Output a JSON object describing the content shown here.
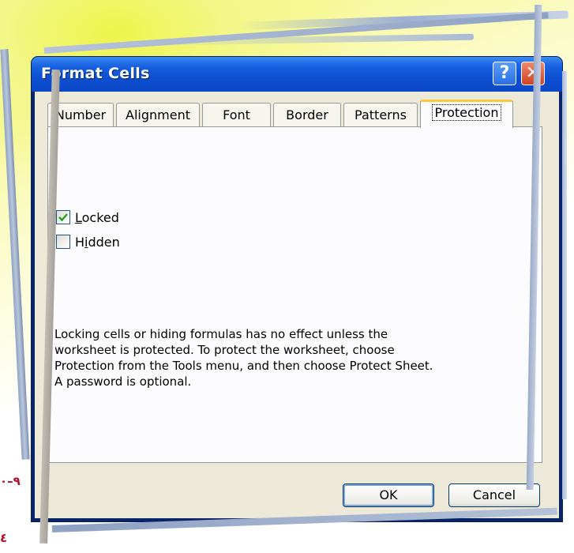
{
  "slide": {
    "page_marker_1": "٩–٠",
    "page_marker_2": "٤"
  },
  "dialog": {
    "title": "Format Cells",
    "help_label": "?",
    "close_label": "✕",
    "tabs": [
      {
        "label": "Number",
        "active": false
      },
      {
        "label": "Alignment",
        "active": false
      },
      {
        "label": "Font",
        "active": false
      },
      {
        "label": "Border",
        "active": false
      },
      {
        "label": "Patterns",
        "active": false
      },
      {
        "label": "Protection",
        "active": true
      }
    ],
    "locked": {
      "label_prefix": "",
      "label_accel": "L",
      "label_rest": "ocked",
      "checked": true
    },
    "hidden": {
      "label_prefix": "H",
      "label_accel": "i",
      "label_rest": "dden",
      "checked": false
    },
    "info_text": "Locking cells or hiding formulas has no effect unless the worksheet is protected. To protect the worksheet, choose Protection from the Tools menu, and then choose Protect Sheet. A password is optional.",
    "ok_label": "OK",
    "cancel_label": "Cancel"
  },
  "colors": {
    "titlebar": "#0c4fd0",
    "dialog_face": "#ece9d8",
    "active_tab_accent": "#ffc83c",
    "checkmark": "#21a121"
  }
}
